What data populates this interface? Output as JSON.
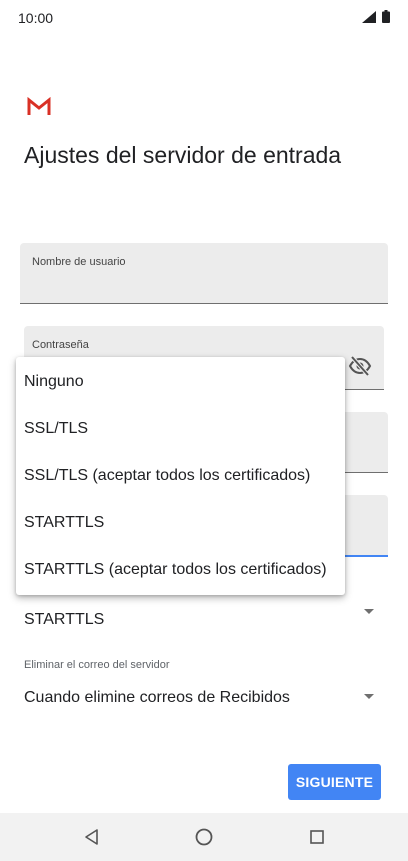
{
  "status_bar": {
    "time": "10:00"
  },
  "page": {
    "title": "Ajustes del servidor de entrada"
  },
  "fields": {
    "username": {
      "label": "Nombre de usuario",
      "value": ""
    },
    "password": {
      "label": "Contraseña",
      "value": ""
    }
  },
  "security": {
    "selected_value": "STARTTLS",
    "options": [
      "Ninguno",
      "SSL/TLS",
      "SSL/TLS (aceptar todos los certificados)",
      "STARTTLS",
      "STARTTLS (aceptar todos los certificados)"
    ]
  },
  "delete_mail": {
    "label": "Eliminar el correo del servidor",
    "value": "Cuando elimine correos de Recibidos"
  },
  "actions": {
    "next_label": "SIGUIENTE"
  },
  "colors": {
    "accent": "#4285f4",
    "gmail_red": "#d93025"
  },
  "icons": {
    "logo": "gmail-icon",
    "password_toggle": "eye-off-icon",
    "nav_back": "back-icon",
    "nav_home": "home-icon",
    "nav_recent": "recents-icon"
  }
}
